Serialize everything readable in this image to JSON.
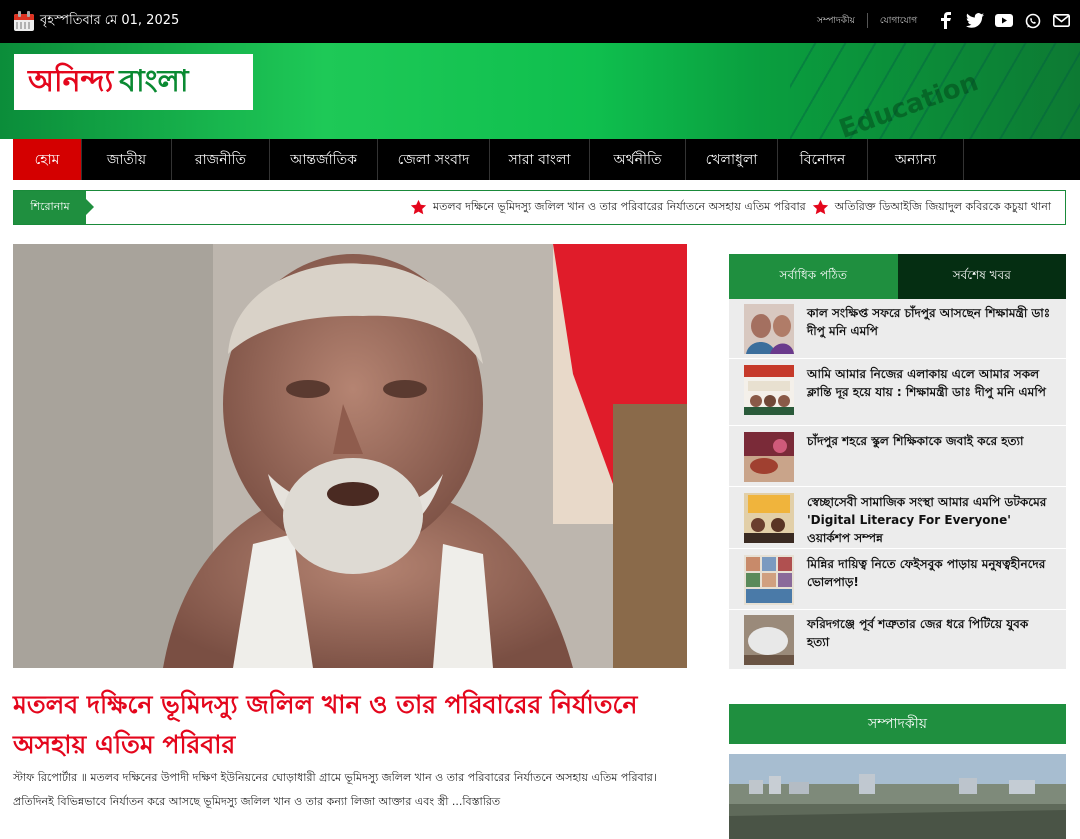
{
  "topbar": {
    "date": "বৃহস্পতিবার মে 01, 2025",
    "links": [
      "সম্পাদকীয়",
      "যোগাযোগ"
    ],
    "social_icons": [
      "facebook-icon",
      "twitter-icon",
      "youtube-icon",
      "whatsapp-icon",
      "mail-icon"
    ]
  },
  "brand": {
    "logo_part1": "অনিন্দ্য",
    "logo_part2": "বাংলা",
    "colors": {
      "red": "#e4061c",
      "green": "#1f8f3f",
      "dark_green": "#052e12"
    }
  },
  "nav": {
    "items": [
      "হোম",
      "জাতীয়",
      "রাজনীতি",
      "আন্তর্জাতিক",
      "জেলা সংবাদ",
      "সারা বাংলা",
      "অর্থনীতি",
      "খেলাধুলা",
      "বিনোদন",
      "অন্যান্য"
    ],
    "active_index": 0
  },
  "ticker": {
    "label": "শিরোনাম",
    "items": [
      "মতলব দক্ষিনে ভূমিদস্যু জলিল খান ও তার পরিবারের নির্যাতনে অসহায় এতিম পরিবার",
      "অতিরিক্ত ডিআইজি জিয়াদুল কবিরকে কচুয়া থানা"
    ]
  },
  "lead": {
    "title": "মতলব দক্ষিনে ভূমিদস্যু জলিল খান ও তার পরিবারের নির্যাতনে অসহায় এতিম পরিবার",
    "summary": "স্টাফ রিপোর্টার ॥ মতলব দক্ষিনের উপাদী দক্ষিণ ইউনিয়নের ঘোড়াধারী গ্রামে ভূমিদস্যু জলিল খান ও তার পরিবারের নির্যাতনে অসহায় এতিম পরিবার। প্রতিদিনই বিভিন্নভাবে নির্যাতন করে আসছে ভূমিদস্যু জলিল খান ও তার কন্যা লিজা আক্তার এবং স্ত্রী",
    "read_more": "...বিস্তারিত"
  },
  "sidebar": {
    "tabs": [
      "সর্বাধিক পঠিত",
      "সর্বশেষ খবর"
    ],
    "active_tab": 1,
    "articles": [
      {
        "title": "কাল সংক্ষিপ্ত সফরে চাঁদপুর আসছেন শিক্ষামন্ত্রী ডাঃ দীপু মনি এমপি"
      },
      {
        "title": "আমি আমার নিজের এলাকায় এলে আমার সকল ক্লান্তি দূর হয়ে যায় : শিক্ষামন্ত্রী ডাঃ দীপু মনি এমপি"
      },
      {
        "title": "চাঁদপুর শহরে স্কুল শিক্ষিকাকে জবাই করে হত্যা"
      },
      {
        "title": "স্বেচ্ছাসেবী সামাজিক সংস্থা আমার এমপি ডটকমের 'Digital Literacy For Everyone' ওয়ার্কশপ সম্পন্ন"
      },
      {
        "title": "মিন্নির দায়িত্ব নিতে ফেইসবুক পাড়ায় মনুষত্বহীনদের ভোলপাড়!"
      },
      {
        "title": "ফরিদগঞ্জে পূর্ব শত্রুতার জের ধরে পিটিয়ে যুবক হত্যা"
      }
    ],
    "editorial_label": "সম্পাদকীয়"
  }
}
